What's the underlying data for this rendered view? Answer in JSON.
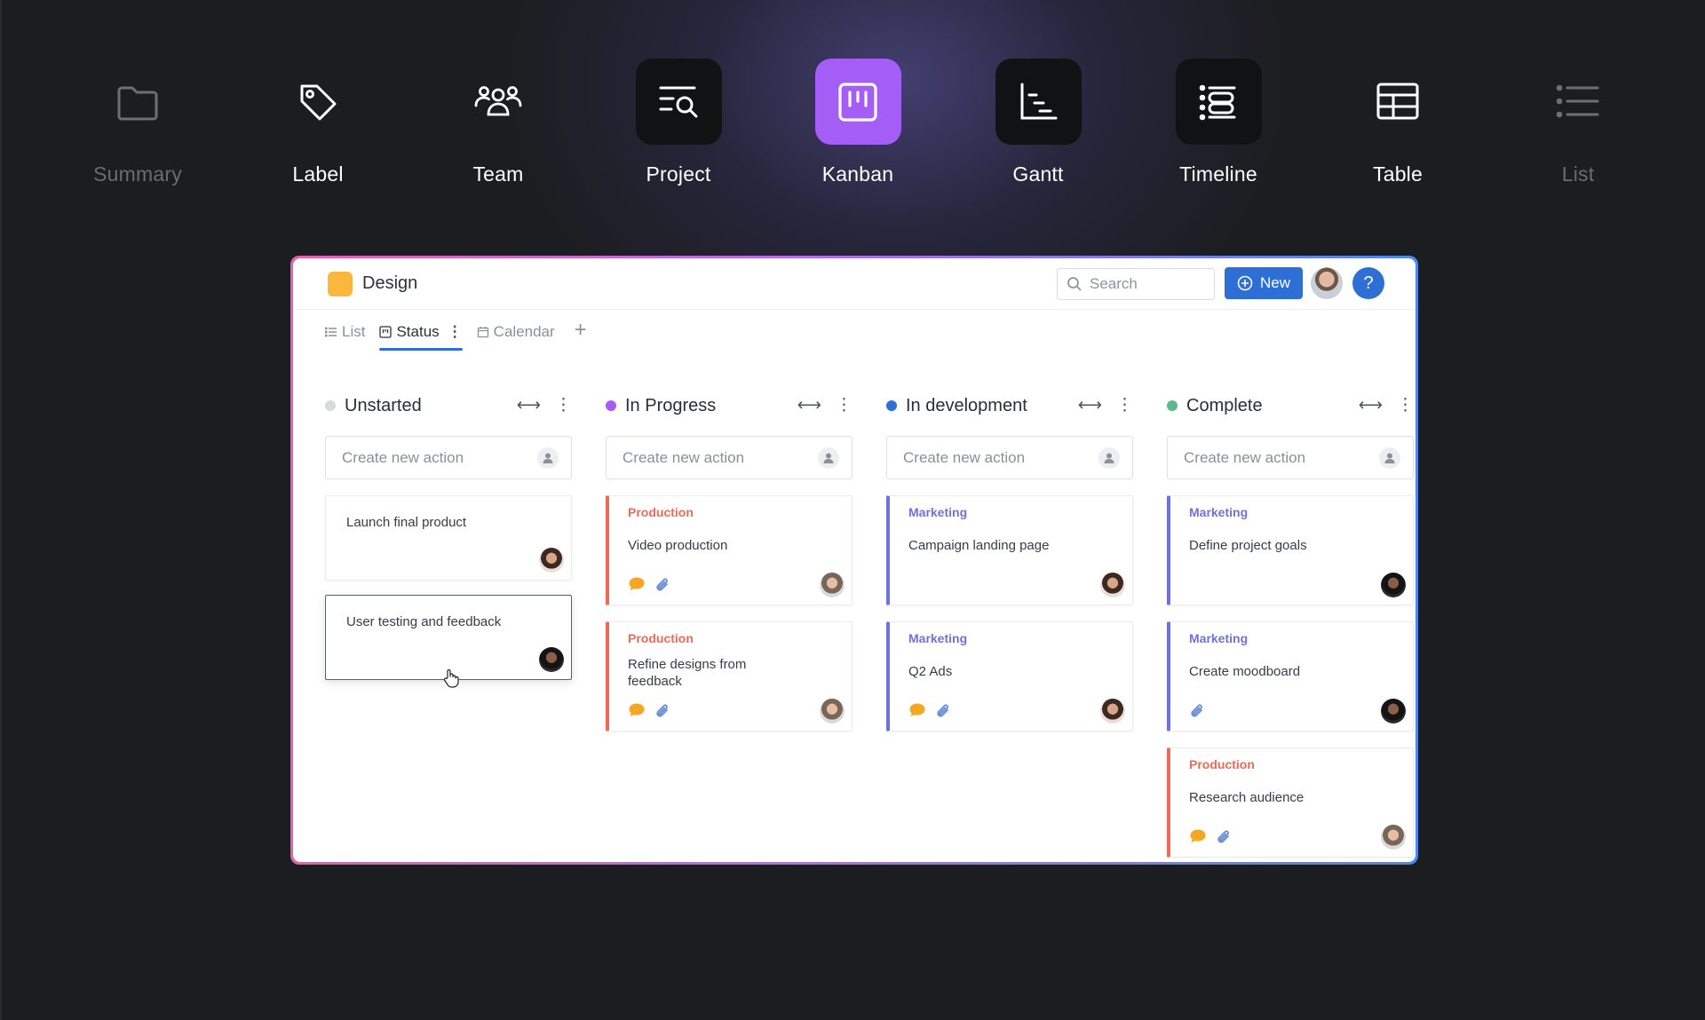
{
  "views": [
    {
      "label": "Summary",
      "icon": "folder-icon",
      "state": "dim"
    },
    {
      "label": "Label",
      "icon": "tag-icon",
      "state": "normal"
    },
    {
      "label": "Team",
      "icon": "team-icon",
      "state": "normal"
    },
    {
      "label": "Project",
      "icon": "project-search-icon",
      "state": "dark"
    },
    {
      "label": "Kanban",
      "icon": "kanban-icon",
      "state": "active"
    },
    {
      "label": "Gantt",
      "icon": "gantt-icon",
      "state": "dark"
    },
    {
      "label": "Timeline",
      "icon": "timeline-icon",
      "state": "dark"
    },
    {
      "label": "Table",
      "icon": "table-icon",
      "state": "normal"
    },
    {
      "label": "List",
      "icon": "list-icon",
      "state": "dim"
    }
  ],
  "app": {
    "project_name": "Design",
    "project_color": "#fbb83c",
    "search_placeholder": "Search",
    "new_label": "New",
    "help_label": "?",
    "accent": "#2e6fd6",
    "tabs": [
      {
        "label": "List",
        "icon": "list-icon"
      },
      {
        "label": "Status",
        "icon": "board-icon",
        "active": true
      },
      {
        "label": "Calendar",
        "icon": "calendar-icon"
      }
    ],
    "add_tab": "+"
  },
  "board": {
    "create_placeholder": "Create new action",
    "columns": [
      {
        "title": "Unstarted",
        "dot_color": "#d8d9dc",
        "cards": [
          {
            "tag": "",
            "title": "Launch final product",
            "comment": false,
            "attachment": false,
            "avatar": "a"
          },
          {
            "tag": "",
            "title": "User testing and feedback",
            "comment": false,
            "attachment": false,
            "avatar": "b",
            "selected": true
          }
        ]
      },
      {
        "title": "In Progress",
        "dot_color": "#a55ef5",
        "cards": [
          {
            "tag": "Production",
            "title": "Video production",
            "comment": true,
            "attachment": true,
            "avatar": "c"
          },
          {
            "tag": "Production",
            "title": "Refine designs from feedback",
            "comment": true,
            "attachment": true,
            "avatar": "c"
          }
        ]
      },
      {
        "title": "In development",
        "dot_color": "#2e6fd6",
        "cards": [
          {
            "tag": "Marketing",
            "title": "Campaign landing page",
            "comment": false,
            "attachment": false,
            "avatar": "a"
          },
          {
            "tag": "Marketing",
            "title": "Q2 Ads",
            "comment": true,
            "attachment": true,
            "avatar": "a"
          }
        ]
      },
      {
        "title": "Complete",
        "dot_color": "#5cb88a",
        "cards": [
          {
            "tag": "Marketing",
            "title": "Define project goals",
            "comment": false,
            "attachment": false,
            "avatar": "b"
          },
          {
            "tag": "Marketing",
            "title": "Create moodboard",
            "comment": false,
            "attachment": true,
            "avatar": "b"
          },
          {
            "tag": "Production",
            "title": "Research audience",
            "comment": true,
            "attachment": true,
            "avatar": "c"
          }
        ]
      }
    ]
  },
  "colors": {
    "production": "#ee6a55",
    "marketing": "#6e72e0",
    "comment": "#f5a623",
    "attachment": "#6b8fd6",
    "kanban_active": "#a55ef5"
  }
}
